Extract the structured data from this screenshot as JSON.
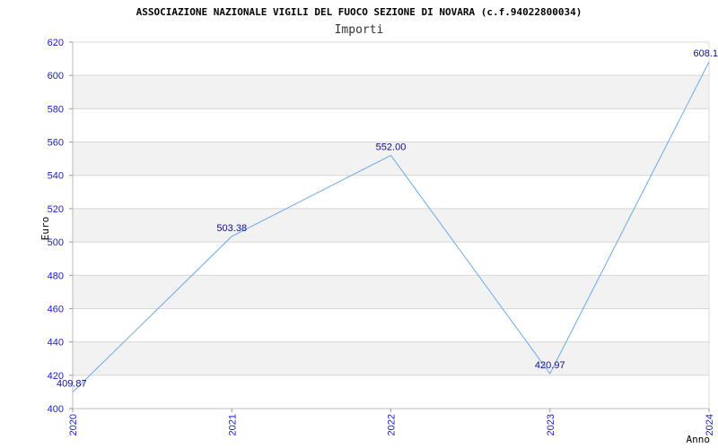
{
  "chart_data": {
    "type": "line",
    "title": "ASSOCIAZIONE NAZIONALE VIGILI DEL FUOCO SEZIONE DI NOVARA (c.f.94022800034)",
    "subtitle": "Importi",
    "xlabel": "Anno",
    "ylabel": "Euro",
    "categories": [
      "2020",
      "2021",
      "2022",
      "2023",
      "2024"
    ],
    "values": [
      409.87,
      503.38,
      552.0,
      420.97,
      608.1
    ],
    "data_labels": [
      "409.87",
      "503.38",
      "552.00",
      "420.97",
      "608.1"
    ],
    "ylim": [
      400,
      620
    ],
    "yticks": [
      "400",
      "420",
      "440",
      "460",
      "480",
      "500",
      "520",
      "540",
      "560",
      "580",
      "600",
      "620"
    ],
    "grid": true,
    "colors": {
      "line": "#6aaaf0",
      "band": "#f2f2f2",
      "grid": "#d8d8d8",
      "tick_text": "#1a1acc",
      "label_text": "#101080"
    }
  }
}
